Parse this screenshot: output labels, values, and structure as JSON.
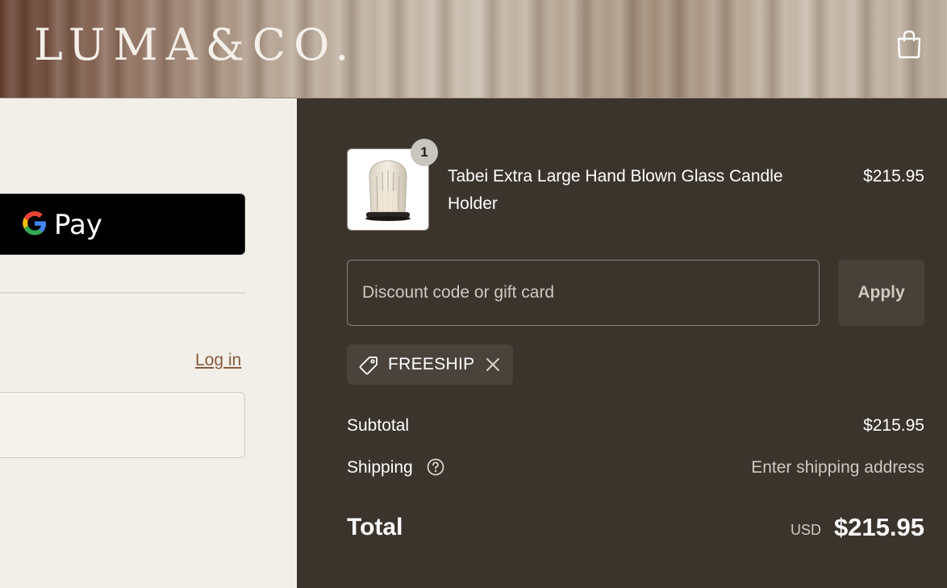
{
  "header": {
    "brand": "LUMA&CO.",
    "cart_icon": "shopping-bag-icon"
  },
  "express_checkout": {
    "gpay_label": "Pay",
    "gpay_icon": "google-g-icon"
  },
  "contact": {
    "login_label": "Log in"
  },
  "order_summary": {
    "product": {
      "name": "Tabei Extra Large Hand Blown Glass Candle Holder",
      "price": "$215.95",
      "quantity": "1"
    },
    "discount": {
      "placeholder": "Discount code or gift card",
      "apply_label": "Apply",
      "applied_code": "FREESHIP",
      "tag_icon": "tag-icon",
      "remove_icon": "close-icon"
    },
    "subtotal_label": "Subtotal",
    "subtotal_value": "$215.95",
    "shipping_label": "Shipping",
    "shipping_help_icon": "question-circle-icon",
    "shipping_value": "Enter shipping address",
    "total_label": "Total",
    "total_currency": "USD",
    "total_value": "$215.95"
  },
  "colors": {
    "summary_bg": "#3b342d",
    "left_bg": "#f1efe8",
    "link": "#8a5a3c",
    "button_dark": "#000000"
  }
}
